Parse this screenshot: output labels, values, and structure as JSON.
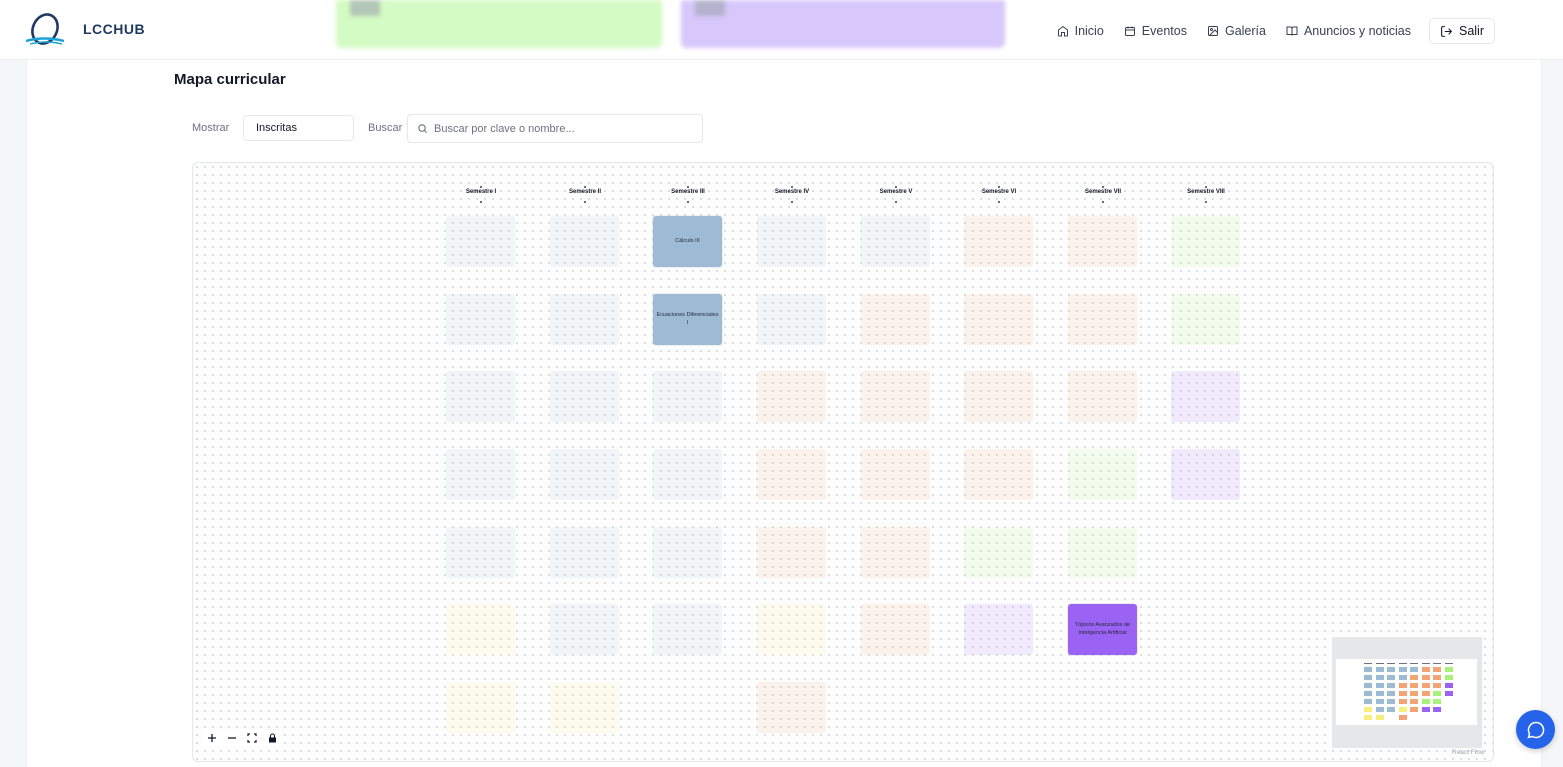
{
  "header": {
    "brand": "LCCHUB",
    "nav": [
      {
        "label": "Inicio",
        "icon": "home-icon"
      },
      {
        "label": "Eventos",
        "icon": "calendar-icon"
      },
      {
        "label": "Galería",
        "icon": "image-icon"
      },
      {
        "label": "Anuncios y noticias",
        "icon": "book-open-icon"
      }
    ],
    "logout_label": "Salir"
  },
  "main": {
    "title": "Mapa curricular",
    "filter": {
      "show_label": "Mostrar",
      "show_value": "Inscritas",
      "search_label": "Buscar",
      "search_placeholder": "Buscar por clave o nombre..."
    }
  },
  "curriculum": {
    "semesters": [
      "Semestre I",
      "Semestre II",
      "Semestre III",
      "Semestre IV",
      "Semestre V",
      "Semestre VI",
      "Semestre VII",
      "Semestre VIII"
    ],
    "colors": {
      "blue": "#9ebbd6",
      "orange": "#f2a477",
      "green": "#a9f27a",
      "purple": "#9b63f4",
      "yellow": "#f6ef7e"
    },
    "courses": [
      {
        "sem": 0,
        "row": 0,
        "color": "blue",
        "label": "",
        "active": false
      },
      {
        "sem": 0,
        "row": 1,
        "color": "blue",
        "label": "",
        "active": false
      },
      {
        "sem": 0,
        "row": 2,
        "color": "blue",
        "label": "",
        "active": false
      },
      {
        "sem": 0,
        "row": 3,
        "color": "blue",
        "label": "",
        "active": false
      },
      {
        "sem": 0,
        "row": 4,
        "color": "blue",
        "label": "",
        "active": false
      },
      {
        "sem": 0,
        "row": 5,
        "color": "yellow",
        "label": "",
        "active": false
      },
      {
        "sem": 0,
        "row": 6,
        "color": "yellow",
        "label": "",
        "active": false
      },
      {
        "sem": 1,
        "row": 0,
        "color": "blue",
        "label": "",
        "active": false
      },
      {
        "sem": 1,
        "row": 1,
        "color": "blue",
        "label": "",
        "active": false
      },
      {
        "sem": 1,
        "row": 2,
        "color": "blue",
        "label": "",
        "active": false
      },
      {
        "sem": 1,
        "row": 3,
        "color": "blue",
        "label": "",
        "active": false
      },
      {
        "sem": 1,
        "row": 4,
        "color": "blue",
        "label": "",
        "active": false
      },
      {
        "sem": 1,
        "row": 5,
        "color": "blue",
        "label": "",
        "active": false
      },
      {
        "sem": 1,
        "row": 6,
        "color": "yellow",
        "label": "",
        "active": false
      },
      {
        "sem": 2,
        "row": 0,
        "color": "blue",
        "label": "Cálculo III",
        "active": true
      },
      {
        "sem": 2,
        "row": 1,
        "color": "blue",
        "label": "Ecuaciones Diferenciales I",
        "active": true
      },
      {
        "sem": 2,
        "row": 2,
        "color": "blue",
        "label": "",
        "active": false
      },
      {
        "sem": 2,
        "row": 3,
        "color": "blue",
        "label": "",
        "active": false
      },
      {
        "sem": 2,
        "row": 4,
        "color": "blue",
        "label": "",
        "active": false
      },
      {
        "sem": 2,
        "row": 5,
        "color": "blue",
        "label": "",
        "active": false
      },
      {
        "sem": 3,
        "row": 0,
        "color": "blue",
        "label": "",
        "active": false
      },
      {
        "sem": 3,
        "row": 1,
        "color": "blue",
        "label": "",
        "active": false
      },
      {
        "sem": 3,
        "row": 2,
        "color": "orange",
        "label": "",
        "active": false
      },
      {
        "sem": 3,
        "row": 3,
        "color": "orange",
        "label": "",
        "active": false
      },
      {
        "sem": 3,
        "row": 4,
        "color": "orange",
        "label": "",
        "active": false
      },
      {
        "sem": 3,
        "row": 5,
        "color": "yellow",
        "label": "",
        "active": false
      },
      {
        "sem": 3,
        "row": 6,
        "color": "orange",
        "label": "",
        "active": false
      },
      {
        "sem": 4,
        "row": 0,
        "color": "blue",
        "label": "",
        "active": false
      },
      {
        "sem": 4,
        "row": 1,
        "color": "orange",
        "label": "",
        "active": false
      },
      {
        "sem": 4,
        "row": 2,
        "color": "orange",
        "label": "",
        "active": false
      },
      {
        "sem": 4,
        "row": 3,
        "color": "orange",
        "label": "",
        "active": false
      },
      {
        "sem": 4,
        "row": 4,
        "color": "orange",
        "label": "",
        "active": false
      },
      {
        "sem": 4,
        "row": 5,
        "color": "orange",
        "label": "",
        "active": false
      },
      {
        "sem": 5,
        "row": 0,
        "color": "orange",
        "label": "",
        "active": false
      },
      {
        "sem": 5,
        "row": 1,
        "color": "orange",
        "label": "",
        "active": false
      },
      {
        "sem": 5,
        "row": 2,
        "color": "orange",
        "label": "",
        "active": false
      },
      {
        "sem": 5,
        "row": 3,
        "color": "orange",
        "label": "",
        "active": false
      },
      {
        "sem": 5,
        "row": 4,
        "color": "green",
        "label": "",
        "active": false
      },
      {
        "sem": 5,
        "row": 5,
        "color": "purple",
        "label": "",
        "active": false
      },
      {
        "sem": 6,
        "row": 0,
        "color": "orange",
        "label": "",
        "active": false
      },
      {
        "sem": 6,
        "row": 1,
        "color": "orange",
        "label": "",
        "active": false
      },
      {
        "sem": 6,
        "row": 2,
        "color": "orange",
        "label": "",
        "active": false
      },
      {
        "sem": 6,
        "row": 3,
        "color": "green",
        "label": "",
        "active": false
      },
      {
        "sem": 6,
        "row": 4,
        "color": "green",
        "label": "",
        "active": false
      },
      {
        "sem": 6,
        "row": 5,
        "color": "purple",
        "label": "Tópicos Avanzados de Inteligencia Artificial",
        "active": true
      },
      {
        "sem": 7,
        "row": 0,
        "color": "green",
        "label": "",
        "active": false
      },
      {
        "sem": 7,
        "row": 1,
        "color": "green",
        "label": "",
        "active": false
      },
      {
        "sem": 7,
        "row": 2,
        "color": "purple",
        "label": "",
        "active": false
      },
      {
        "sem": 7,
        "row": 3,
        "color": "purple",
        "label": "",
        "active": false
      }
    ]
  },
  "flow_attribution": "React Flow"
}
